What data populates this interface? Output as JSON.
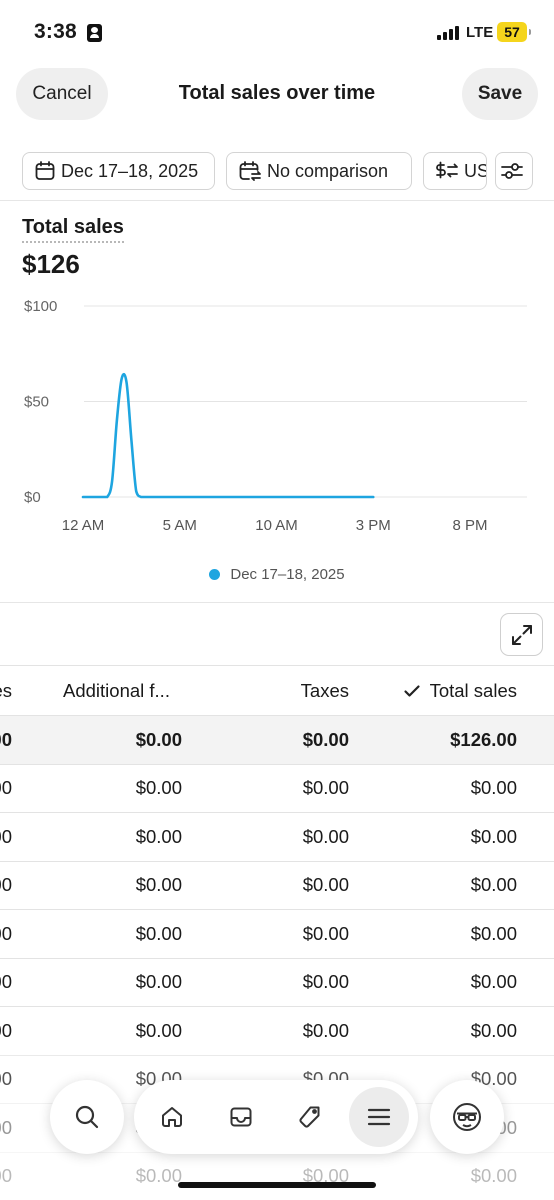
{
  "status_bar": {
    "time": "3:38",
    "network": "LTE",
    "battery": "57"
  },
  "header": {
    "cancel_label": "Cancel",
    "title": "Total sales over time",
    "save_label": "Save"
  },
  "filters": {
    "date_range": "Dec 17–18, 2025",
    "comparison": "No comparison",
    "currency": "US"
  },
  "metric": {
    "label": "Total sales",
    "value": "$126"
  },
  "colors": {
    "series": "#1ea5e0",
    "grid": "#e4e4e4"
  },
  "chart_data": {
    "type": "line",
    "series": [
      {
        "name": "Dec 17–18, 2025",
        "x_hours": [
          0,
          0.25,
          0.5,
          0.75,
          1,
          1.25,
          1.5,
          1.75,
          2,
          2.25,
          2.5,
          2.75,
          3,
          3.25,
          3.5,
          4,
          5,
          6,
          7,
          8,
          9,
          10,
          11,
          12,
          13,
          14,
          15
        ],
        "values": [
          0,
          0,
          0,
          0,
          0,
          0,
          8,
          40,
          62,
          60,
          30,
          3,
          0,
          0,
          0,
          0,
          0,
          0,
          0,
          0,
          0,
          0,
          0,
          0,
          0,
          0,
          0
        ]
      }
    ],
    "x_ticks": [
      "12 AM",
      "5 AM",
      "10 AM",
      "3 PM",
      "8 PM"
    ],
    "y_ticks": [
      "$100",
      "$50",
      "$0"
    ],
    "xlim": [
      0,
      23
    ],
    "ylim": [
      0,
      100
    ],
    "grid": true,
    "legend": "bottom-center"
  },
  "table": {
    "columns": [
      "es",
      "Additional f...",
      "Taxes",
      "Total sales"
    ],
    "sorted_column": "Total sales",
    "total_row": [
      "00",
      "$0.00",
      "$0.00",
      "$126.00"
    ],
    "rows": [
      [
        "00",
        "$0.00",
        "$0.00",
        "$0.00"
      ],
      [
        "00",
        "$0.00",
        "$0.00",
        "$0.00"
      ],
      [
        "00",
        "$0.00",
        "$0.00",
        "$0.00"
      ],
      [
        "00",
        "$0.00",
        "$0.00",
        "$0.00"
      ],
      [
        "00",
        "$0.00",
        "$0.00",
        "$0.00"
      ],
      [
        "00",
        "$0.00",
        "$0.00",
        "$0.00"
      ],
      [
        "00",
        "$0.00",
        "$0.00",
        "$0.00"
      ],
      [
        "00",
        "$0.00",
        "$0.00",
        "$0.00"
      ],
      [
        "00",
        "$0.00",
        "$0.00",
        "$0.00"
      ]
    ]
  },
  "nav": {
    "icons": [
      "search-icon",
      "home-icon",
      "inbox-icon",
      "tag-icon",
      "menu-icon",
      "avatar-icon"
    ],
    "active": "menu-icon"
  }
}
